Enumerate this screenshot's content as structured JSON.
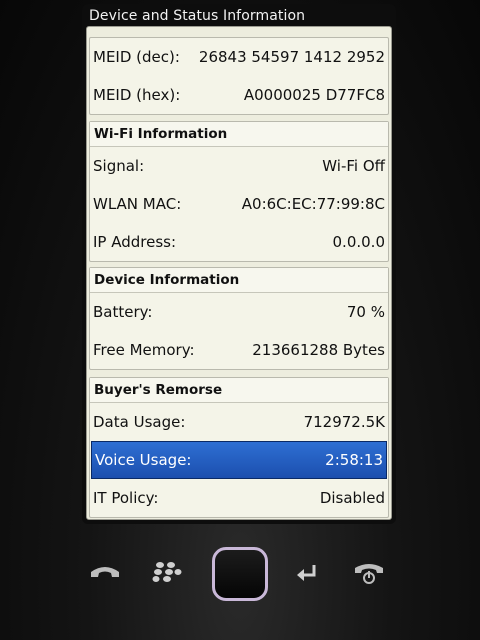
{
  "title": "Device and Status Information",
  "meid_rows": [
    {
      "label": "MEID (dec):",
      "value": "26843 54597 1412 2952"
    },
    {
      "label": "MEID (hex):",
      "value": "A0000025 D77FC8"
    }
  ],
  "wifi": {
    "header": "Wi-Fi Information",
    "rows": [
      {
        "label": "Signal:",
        "value": "Wi-Fi Off"
      },
      {
        "label": "WLAN MAC:",
        "value": "A0:6C:EC:77:99:8C"
      },
      {
        "label": "IP Address:",
        "value": "0.0.0.0"
      }
    ]
  },
  "device": {
    "header": "Device Information",
    "rows": [
      {
        "label": "Battery:",
        "value": "70 %"
      },
      {
        "label": "Free Memory:",
        "value": "213661288 Bytes"
      }
    ]
  },
  "remorse": {
    "header": "Buyer's Remorse",
    "rows": [
      {
        "label": "Data Usage:",
        "value": "712972.5K"
      },
      {
        "label": "Voice Usage:",
        "value": "2:58:13"
      },
      {
        "label": "IT Policy:",
        "value": "Disabled"
      }
    ]
  },
  "nav_icons": [
    "call-icon",
    "blackberry-menu-icon",
    "trackpad",
    "back-icon",
    "end-call-icon"
  ]
}
